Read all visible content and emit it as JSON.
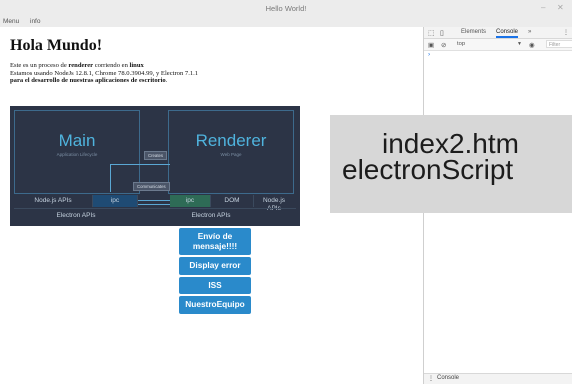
{
  "window": {
    "title": "Hello World!",
    "minimize_glyph": "–",
    "close_glyph": "✕"
  },
  "menubar": {
    "items": [
      "Menu",
      "info"
    ]
  },
  "page": {
    "heading": "Hola Mundo!",
    "line1_prefix": "Este es un proceso de ",
    "line1_bold1": "renderer",
    "line1_mid": " corriendo en ",
    "line1_bold2": "linux",
    "line2": "Estamos usando NodeJs 12.8.1, Chrome 78.0.3904.99, y Electron 7.1.1",
    "line3_bold": "para el desarrollo de nuestras aplicaciones de escritorio",
    "line3_end": "."
  },
  "diagram": {
    "main_title": "Main",
    "main_sub": "Application Lifecycle",
    "renderer_title": "Renderer",
    "renderer_sub": "Web Page",
    "creates": "Creates",
    "communicates": "Communicates",
    "cells": {
      "node_apis_left": "Node.js APIs",
      "ipc_left": "ipc",
      "ipc_right": "ipc",
      "dom": "DOM",
      "node_apis_right_1": "Node.js",
      "node_apis_right_2": "APIs"
    },
    "electron_apis_left": "Electron APIs",
    "electron_apis_right": "Electron APIs"
  },
  "buttons": {
    "envio_line1": "Envío de",
    "envio_line2": "mensaje!!!!",
    "display_error": "Display error",
    "iss": "ISS",
    "nuestro_equipo": "NuestroEquipo"
  },
  "overlay": {
    "line1": "index2.htm",
    "line2": "electronScript"
  },
  "devtools": {
    "tabs": [
      "Elements",
      "Console"
    ],
    "active_tab": "Console",
    "more_glyph": "»",
    "menu_glyph": "⋮",
    "context": "top",
    "filter_placeholder": "Filter",
    "prompt_glyph": "›",
    "drawer_title": "Console",
    "drawer_menu_glyph": "⋮"
  },
  "colors": {
    "button_bg": "#2a8acb",
    "diagram_bg": "#2c3446",
    "diagram_accent": "#4fb3dd",
    "overlay_bg": "#d7d7d7"
  }
}
